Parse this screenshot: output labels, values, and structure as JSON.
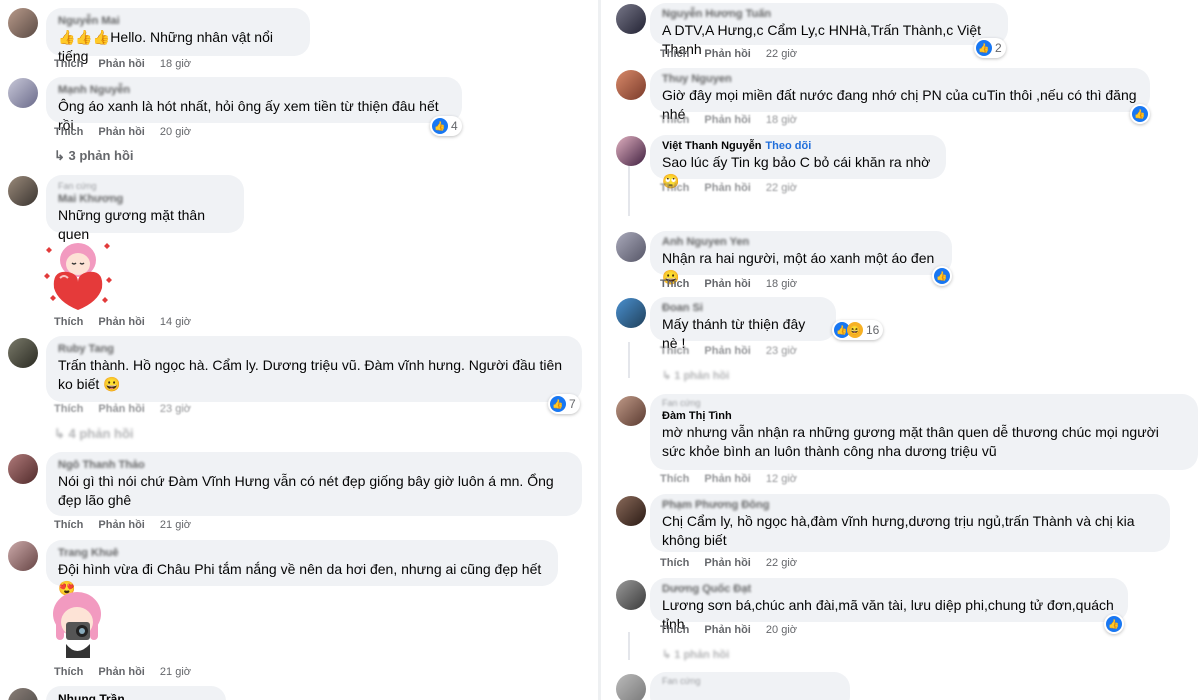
{
  "actions": {
    "like": "Thích",
    "reply": "Phản hồi"
  },
  "left": [
    {
      "name": "Nguyễn Mai",
      "text": "👍👍👍Hello. Những nhân vật nổi tiếng",
      "time": "18 giờ"
    },
    {
      "name": "Mạnh Nguyễn",
      "text": "Ông áo xanh là hót nhất, hỏi ông ấy xem tiền từ thiện đâu hết rồi",
      "time": "20 giờ",
      "likes": "4",
      "replies": "3 phản hồi"
    },
    {
      "fan": "Fan cứng",
      "name": "Mai Khương",
      "text": "Những gương mặt thân quen",
      "time": "14 giờ"
    },
    {
      "name": "Ruby Tang",
      "text": "Trấn thành. Hồ ngọc hà. Cẩm ly. Dương triệu vũ. Đàm vĩnh hưng. Người đầu tiên ko biết 😀",
      "time": "23 giờ",
      "likes": "7",
      "replies": "4 phản hồi"
    },
    {
      "name": "Ngô Thanh Thảo",
      "text": "Nói gì thì nói chứ Đàm Vĩnh Hưng vẫn có nét đẹp giống bây giờ luôn á mn. Ổng đẹp lão ghê",
      "time": "21 giờ"
    },
    {
      "name": "Trang Khuê",
      "text": "Đội hình vừa đi Châu Phi tắm nắng về nên da hơi đen, nhưng ai cũng đẹp hết 😍",
      "time": "21 giờ"
    },
    {
      "name": "Nhung Trần"
    }
  ],
  "right": [
    {
      "name": "Nguyễn Hương Tuấn",
      "text": "A DTV,A Hưng,c Cẩm Ly,c HNHà,Trấn Thành,c Việt Thanh",
      "time": "22 giờ",
      "likes": "2"
    },
    {
      "name": "Thuy Nguyen",
      "text": "Giờ đây mọi miền đất nước đang nhớ chị PN của cuTin thôi ,nếu có thì đăng nhé",
      "time": "18 giờ"
    },
    {
      "name": "Việt Thanh Nguyễn",
      "follow": "Theo dõi",
      "text": "Sao lúc ấy Tin kg bảo C bỏ cái khăn ra nhờ 🙄",
      "time": "22 giờ"
    },
    {
      "name": "Anh Nguyen Yen",
      "text": "Nhận ra hai người, một áo xanh một áo đen 😀",
      "time": "18 giờ"
    },
    {
      "name": "Đoan Si",
      "text": "Mấy thánh từ thiện đây nè !",
      "time": "23 giờ",
      "likes": "16",
      "replies": "1 phản hồi"
    },
    {
      "fan": "Fan cứng",
      "name": "Đàm Thị Tình",
      "text": "mờ nhưng vẫn nhận ra những gương mặt thân quen dễ thương chúc mọi người sức khỏe bình an luôn thành công nha dương triệu vũ",
      "time": "12 giờ"
    },
    {
      "name": "Phạm Phương Đông",
      "text": "Chị Cẩm ly, hồ ngọc hà,đàm vĩnh hưng,dương trịu ngủ,trấn Thành và chị kia không biết",
      "time": "22 giờ"
    },
    {
      "name": "Dương Quốc Đạt",
      "text": "Lương sơn bá,chúc anh đài,mã văn tài, lưu diệp phi,chung tử đơn,quách tỉnh",
      "time": "20 giờ",
      "replies": "1 phản hồi"
    },
    {
      "fan": "Fan cứng"
    }
  ]
}
